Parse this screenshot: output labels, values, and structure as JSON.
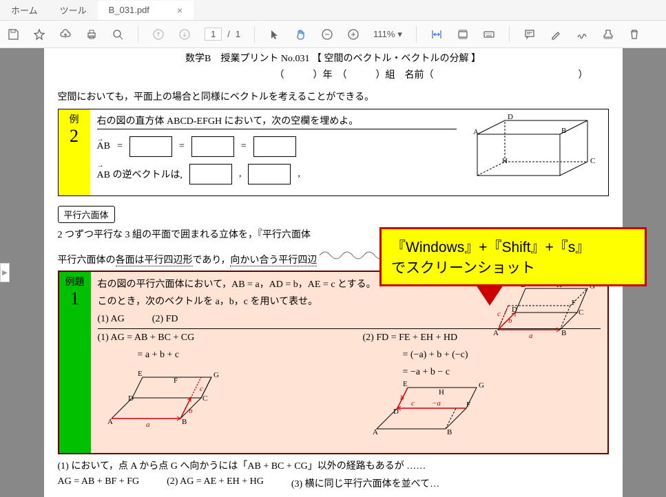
{
  "tabs": {
    "home": "ホーム",
    "tools": "ツール",
    "file": "B_031.pdf"
  },
  "toolbar": {
    "page_cur": "1",
    "page_sep": "/",
    "page_total": "1",
    "zoom": "111%"
  },
  "doc": {
    "title": "数学B　授業プリント No.031 【 空間のベクトル・ベクトルの分解 】",
    "info": "（　　　）年　（　　　）組　名前（　　　　　　　　　　　　　　　）",
    "intro": "空間においても，平面上の場合と同様にベクトルを考えることができる。",
    "ex2_label": "例",
    "ex2_num": "2",
    "ex2_text": "右の図の直方体 ABCD-EFGH において，次の空欄を埋めよ。",
    "ex2_ab": "AB",
    "ex2_eq": "=",
    "ex2_rev": "AB の逆ベクトルは,",
    "ex2_comma": ",",
    "sub": "平行六面体",
    "para1": "2 つずつ平行な 3 組の平面で囲まれる立体を，『平行六面体",
    "para2_a": "平行六面体の",
    "para2_b": "各面は平行四辺形",
    "para2_c": "であり，",
    "para2_d": "向かい合う平行四辺",
    "ex1_label": "例題",
    "ex1_num": "1",
    "ex1_l1": "右の図の平行六面体において，AB = a，AD = b，AE = c とする。",
    "ex1_l2": "このとき，次のベクトルを a，b，c を用いて表せ。",
    "ex1_q1": "(1) AG",
    "ex1_q2": "(2) FD",
    "ex1_a1_1": "(1) AG = AB + BC + CG",
    "ex1_a1_2": "= a + b + c",
    "ex1_a2_1": "(2) FD = FE + EH + HD",
    "ex1_a2_2": "= (−a) + b + (−c)",
    "ex1_a2_3": "= −a + b − c",
    "foot1": "(1) において，点 A から点 G へ向かうには「AB + BC + CG」以外の経路もあるが ……",
    "foot2a": "AG = AB + BF + FG",
    "foot2b": "(2) AG = AE + EH + HG",
    "foot2c": "(3) 横に同じ平行六面体を並べて…"
  },
  "callout": {
    "line1": "『Windows』+『Shift』+『s』",
    "line2": "でスクリーンショット"
  }
}
